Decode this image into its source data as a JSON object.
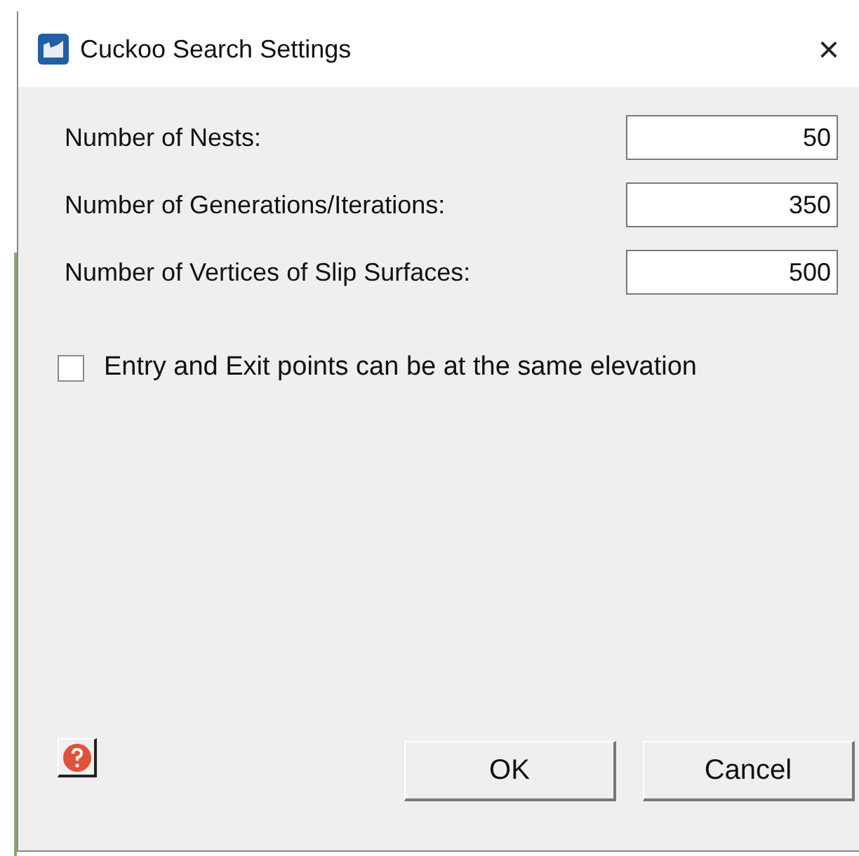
{
  "window": {
    "title": "Cuckoo Search Settings",
    "close": "×"
  },
  "fields": [
    {
      "label": "Number of Nests:",
      "value": "50"
    },
    {
      "label": "Number of Generations/Iterations:",
      "value": "350"
    },
    {
      "label": "Number of Vertices of Slip Surfaces:",
      "value": "500"
    }
  ],
  "option": {
    "label": "Entry and Exit points can be at the same elevation",
    "checked": false
  },
  "buttons": [
    {
      "label": "OK"
    },
    {
      "label": "Cancel"
    }
  ]
}
